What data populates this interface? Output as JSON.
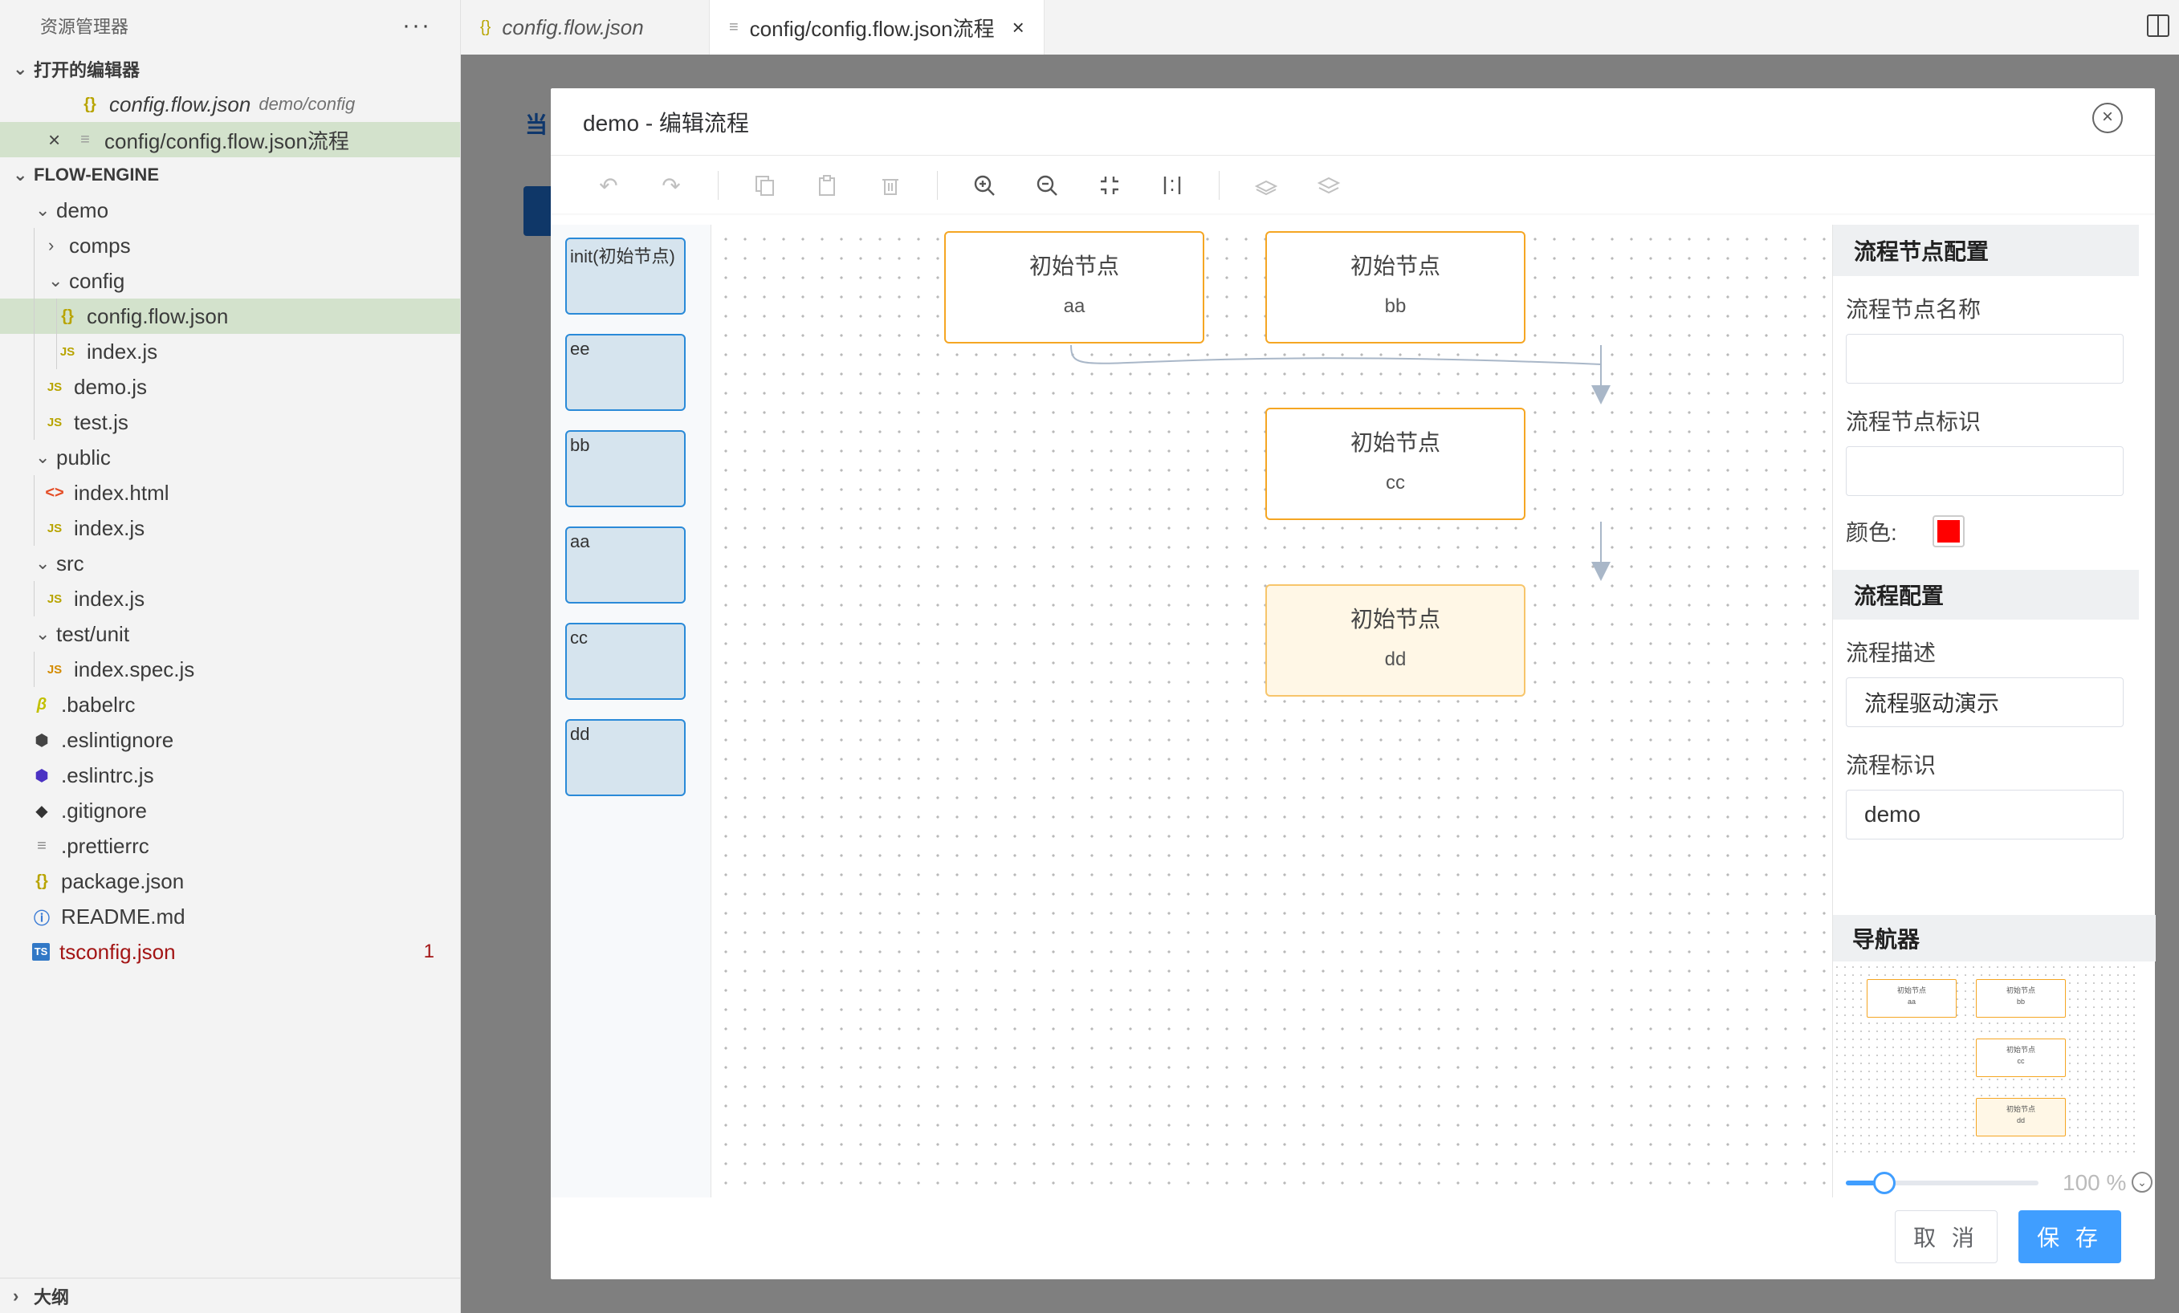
{
  "sidebar": {
    "title": "资源管理器",
    "more": "···",
    "open_editors": {
      "label": "打开的编辑器",
      "items": [
        {
          "name": "config.flow.json",
          "desc": "demo/config"
        },
        {
          "name": "config/config.flow.json流程",
          "close": "×"
        }
      ]
    },
    "project": {
      "label": "FLOW-ENGINE",
      "tree": [
        "demo",
        "comps",
        "config",
        "config.flow.json",
        "index.js",
        "demo.js",
        "test.js",
        "public",
        "index.html",
        "index.js",
        "src",
        "index.js",
        "test/unit",
        "index.spec.js",
        ".babelrc",
        ".eslintignore",
        ".eslintrc.js",
        ".gitignore",
        ".prettierrc",
        "package.json",
        "README.md",
        "tsconfig.json"
      ],
      "error_count": "1"
    },
    "outline_label": "大纲"
  },
  "tabs": [
    {
      "label": "config.flow.json",
      "icon": "{}"
    },
    {
      "label": "config/config.flow.json流程",
      "close": "×"
    }
  ],
  "editor_bg": {
    "partial_text": "当"
  },
  "dialog": {
    "title": "demo - 编辑流程",
    "close": "×",
    "panel_nodes": [
      "init(初始节点)",
      "ee",
      "bb",
      "aa",
      "cc",
      "dd"
    ],
    "canvas_nodes": [
      {
        "title": "初始节点",
        "sub": "aa"
      },
      {
        "title": "初始节点",
        "sub": "bb"
      },
      {
        "title": "初始节点",
        "sub": "cc"
      },
      {
        "title": "初始节点",
        "sub": "dd"
      }
    ],
    "right_panel": {
      "node_config_title": "流程节点配置",
      "node_name_label": "流程节点名称",
      "node_name_value": "",
      "node_id_label": "流程节点标识",
      "node_id_value": "",
      "color_label": "颜色:",
      "color_value": "#ff0000",
      "flow_config_title": "流程配置",
      "flow_desc_label": "流程描述",
      "flow_desc_value": "流程驱动演示",
      "flow_id_label": "流程标识",
      "flow_id_value": "demo",
      "navigator_title": "导航器",
      "zoom_text": "100 %",
      "zoom_level": 0.2
    },
    "buttons": {
      "cancel": "取 消",
      "save": "保 存"
    }
  },
  "colors": {
    "node_border": "#f5a623",
    "palette_border": "#2a8ad8",
    "primary": "#409eff"
  }
}
